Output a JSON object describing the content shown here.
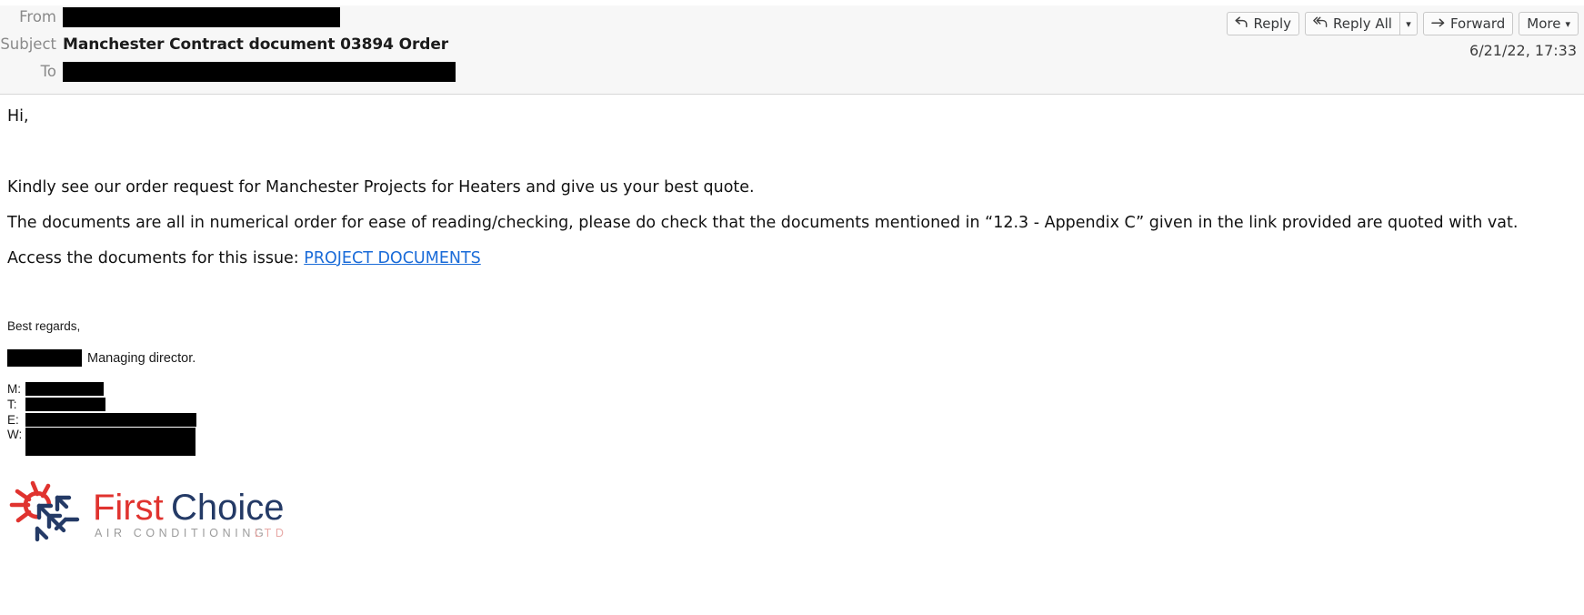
{
  "header": {
    "from_label": "From",
    "from_value_redacted": true,
    "subject_label": "Subject",
    "subject_value": "Manchester Contract document 03894 Order",
    "to_label": "To",
    "to_value_redacted": true,
    "date": "6/21/22, 17:33"
  },
  "toolbar": {
    "reply_label": "Reply",
    "reply_icon": "reply-arrow-icon",
    "reply_all_label": "Reply All",
    "reply_all_icon": "reply-all-arrow-icon",
    "reply_all_caret_icon": "chevron-down-icon",
    "forward_label": "Forward",
    "forward_icon": "forward-arrow-icon",
    "more_label": "More",
    "more_caret_icon": "chevron-down-icon"
  },
  "body": {
    "greeting": "Hi,",
    "paragraph_1": "Kindly see our order request for Manchester Projects for Heaters and give us your best quote.",
    "paragraph_2": "The documents are all in numerical order for ease of reading/checking, please do check that the documents mentioned in “12.3 - Appendix C” given in the link provided are quoted with vat.",
    "access_prefix": "Access the documents for this issue: ",
    "link_text": "PROJECT DOCUMENTS",
    "link_color": "#1a6bd8"
  },
  "signature": {
    "regards": "Best regards,",
    "name_redacted": true,
    "role": "Managing director.",
    "contacts": [
      {
        "key": "M:",
        "value_redacted": true
      },
      {
        "key": "T:",
        "value_redacted": true
      },
      {
        "key": "E:",
        "value_redacted": true
      },
      {
        "key": "W:",
        "value_redacted": true
      }
    ]
  },
  "logo": {
    "word_first": "First",
    "word_choice": "Choice",
    "tagline": "AIR CONDITIONING",
    "tagline_suffix": "LTD",
    "color_red": "#e0332f",
    "color_navy": "#243a66",
    "color_grey": "#9b9b9b",
    "color_pink": "#e8a9a6"
  }
}
